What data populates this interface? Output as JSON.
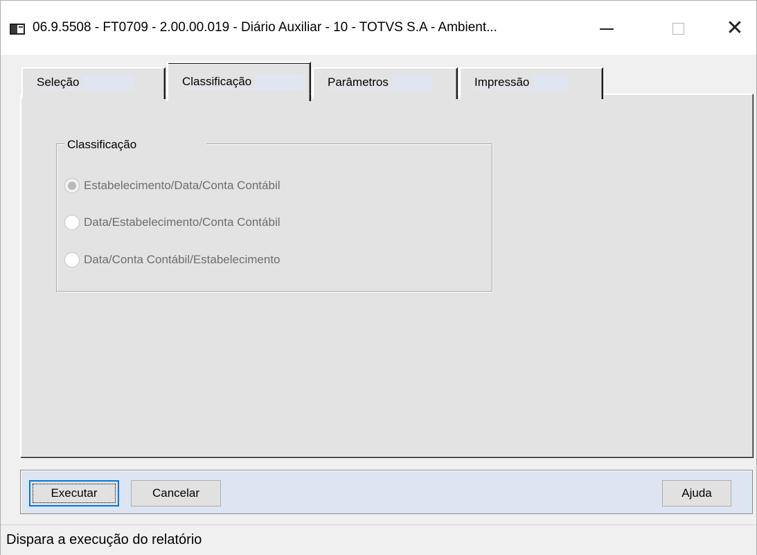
{
  "window": {
    "title": "06.9.5508 - FT0709 - 2.00.00.019 - Diário Auxiliar - 10 - TOTVS S.A - Ambient...",
    "icon": "app-window-icon",
    "controls": {
      "minimize": "minimize-icon",
      "maximize": "maximize-icon",
      "close": "close-icon"
    }
  },
  "tabs": [
    {
      "label": "Seleção",
      "selected": false
    },
    {
      "label": "Classificação",
      "selected": true
    },
    {
      "label": "Parâmetros",
      "selected": false
    },
    {
      "label": "Impressão",
      "selected": false
    }
  ],
  "classificacao_group": {
    "title": "Classificação",
    "options": [
      {
        "label": "Estabelecimento/Data/Conta Contábil",
        "checked": true,
        "enabled": false
      },
      {
        "label": "Data/Estabelecimento/Conta Contábil",
        "checked": false,
        "enabled": false
      },
      {
        "label": "Data/Conta Contábil/Estabelecimento",
        "checked": false,
        "enabled": false
      }
    ]
  },
  "buttons": {
    "executar": "Executar",
    "cancelar": "Cancelar",
    "ajuda": "Ajuda"
  },
  "status_bar": {
    "text": "Dispara a execução do relatório"
  },
  "colors": {
    "window_bg": "#f0f0f0",
    "panel_bg": "#e3e3e3",
    "button_bar_bg": "#dce5f1",
    "focus_border": "#0078d7",
    "disabled_text": "#6d6d6d"
  }
}
